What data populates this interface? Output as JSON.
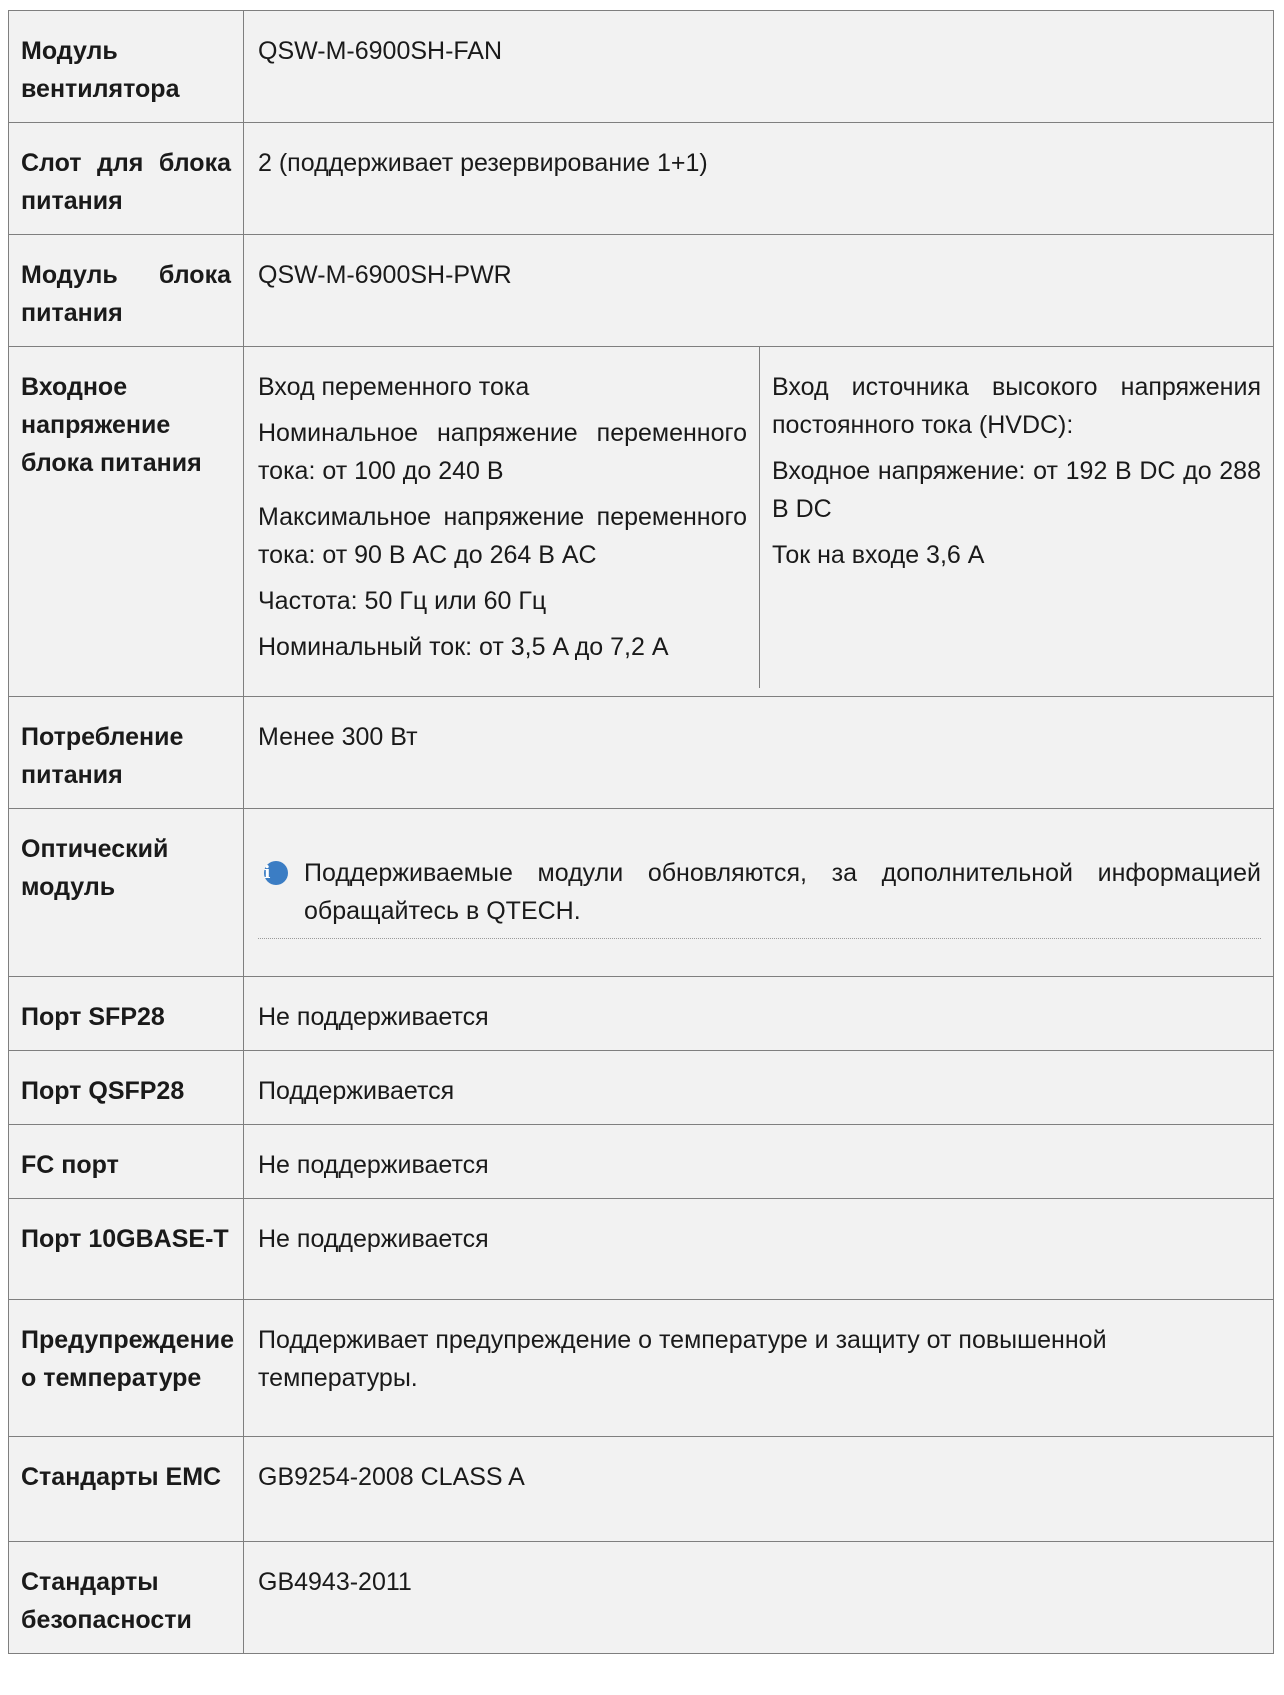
{
  "rows": [
    {
      "label": "Модуль вентилятора",
      "value": "QSW-M-6900SH-FAN"
    },
    {
      "label": "Слот для блока питания",
      "value": "2 (поддерживает резервирование 1+1)"
    },
    {
      "label": "Модуль блока питания",
      "value": "QSW-M-6900SH-PWR"
    },
    {
      "label": "Входное напряжение блока питания",
      "ac": {
        "title": "Вход переменного тока",
        "lines": [
          "Номинальное напряжение переменного тока: от 100 до 240 В",
          "Максимальное напряжение переменного тока: от 90 В AC до 264 В AC",
          "Частота: 50 Гц или 60 Гц",
          "Номинальный ток: от 3,5 A до 7,2 A"
        ]
      },
      "dc": {
        "title": "Вход источника высокого напряжения постоянного тока (HVDC):",
        "lines": [
          "Входное напряжение: от 192 В DC до 288 В DC",
          "Ток на входе 3,6 А"
        ]
      }
    },
    {
      "label": "Потребление питания",
      "value": "Менее 300 Вт"
    },
    {
      "label": "Оптический модуль",
      "note": "Поддерживаемые модули обновляются, за дополнительной информацией обращайтесь в QTECH."
    },
    {
      "label": "Порт SFP28",
      "value": "Не поддерживается"
    },
    {
      "label": "Порт QSFP28",
      "value": "Поддерживается"
    },
    {
      "label": "FC порт",
      "value": "Не поддерживается"
    },
    {
      "label": "Порт 10GBASE-T",
      "value": "Не поддерживается"
    },
    {
      "label": "Предупреждение о температуре",
      "value": "Поддерживает предупреждение о температуре и защиту от повышенной температуры."
    },
    {
      "label": "Стандарты EMC",
      "value": "GB9254-2008 CLASS A"
    },
    {
      "label": "Стандарты безопасности",
      "value": "GB4943-2011"
    }
  ]
}
